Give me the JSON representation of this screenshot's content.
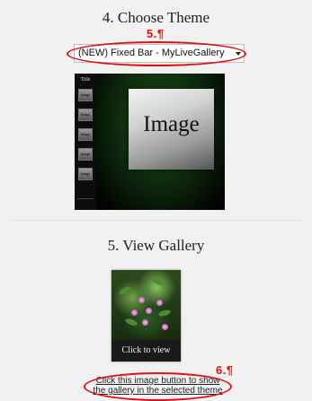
{
  "step4": {
    "title": "4. Choose Theme",
    "annotation": "5.¶",
    "theme_select_value": "(NEW) Fixed Bar - MyLiveGallery",
    "preview": {
      "sidebar_title": "Title",
      "thumbnail_label": "Image",
      "main_image_label": "Image"
    }
  },
  "step5": {
    "title": "5. View Gallery",
    "annotation": "6.¶",
    "thumbnail_caption": "Click to view",
    "link_line1": "Click this image button to show",
    "link_line2": "the gallery in the selected theme"
  },
  "colors": {
    "annotation_red": "#e01010",
    "background": "#f1f1f1",
    "preview_green": "#1a4d1a"
  }
}
